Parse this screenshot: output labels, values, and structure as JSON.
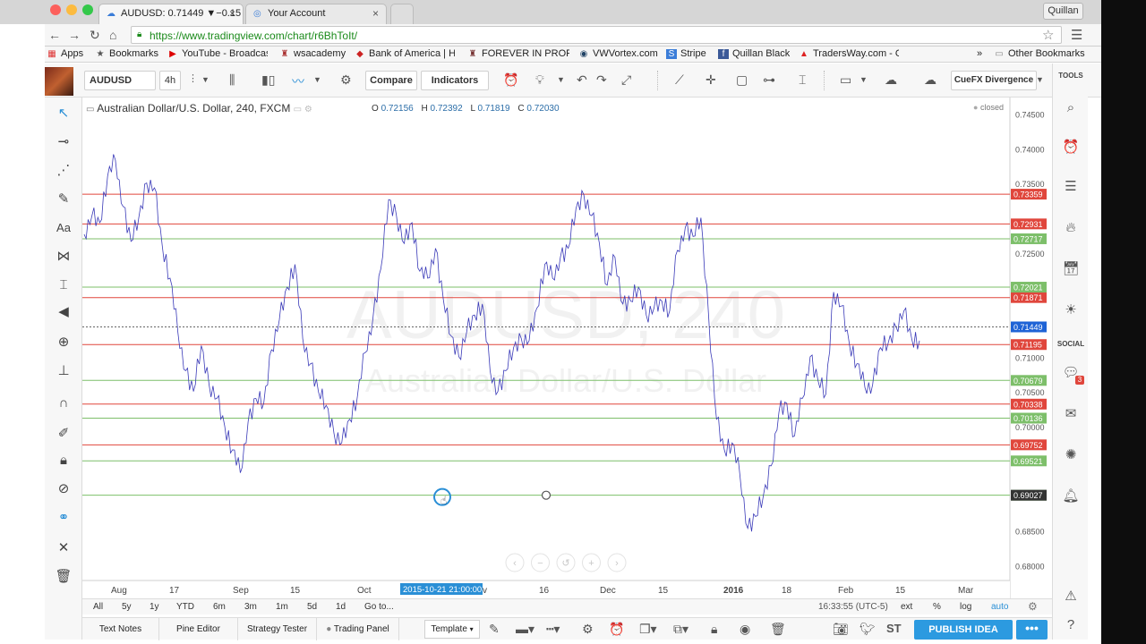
{
  "browser": {
    "tabs": [
      {
        "title": "AUDUSD: 0.71449 ▼−0.15",
        "active": true
      },
      {
        "title": "Your Account",
        "active": false
      }
    ],
    "user": "Quillan",
    "url": "https://www.tradingview.com/chart/r6BhToIt/",
    "bookmarks": [
      "Apps",
      "Bookmarks",
      "YouTube - Broadcast",
      "wsacademy",
      "Bank of America | Ho",
      "FOREVER IN PROFIT",
      "VWVortex.com",
      "Stripe",
      "Quillan Black",
      "TradersWay.com - O",
      "Other Bookmarks"
    ],
    "bookmarks_more": "»"
  },
  "toolbar": {
    "symbol": "AUDUSD",
    "interval": "4h",
    "compare": "Compare",
    "indicators": "Indicators",
    "template_name": "CueFX Divergence",
    "tools_label": "TOOLS",
    "social_label": "SOCIAL",
    "social_badge": "3"
  },
  "chart_header": {
    "title": "Australian Dollar/U.S. Dollar, 240, FXCM",
    "o_label": "O",
    "o_value": "0.72156",
    "h_label": "H",
    "h_value": "0.72392",
    "l_label": "L",
    "l_value": "0.71819",
    "c_label": "C",
    "c_value": "0.72030",
    "status": "closed"
  },
  "watermark": {
    "line1": "AUDUSD, 240",
    "line2": "Australian Dollar/U.S. Dollar"
  },
  "chart_data": {
    "type": "line",
    "series_color": "#3a3ab8",
    "ylim": [
      0.678,
      0.7475
    ],
    "y_ticks": [
      "0.74500",
      "0.74000",
      "0.73500",
      "0.72500",
      "0.71000",
      "0.70500",
      "0.70000",
      "0.68500",
      "0.68000"
    ],
    "x_ticks": [
      "Aug",
      "17",
      "Sep",
      "15",
      "Oct",
      "16",
      "Dec",
      "15",
      "2016",
      "18",
      "Feb",
      "15",
      "Mar"
    ],
    "x_ticks_partial": "v",
    "crosshair_date": "2015-10-21 21:00:00",
    "last_price": "0.71449",
    "resistance_levels": [
      "0.73359",
      "0.72931",
      "0.71871",
      "0.71195",
      "0.70338",
      "0.69752"
    ],
    "support_levels": [
      "0.72717",
      "0.72021",
      "0.70679",
      "0.70136",
      "0.69521",
      "0.69027"
    ],
    "colors": {
      "resistance": "#e0463c",
      "support": "#7dbf6a",
      "last": "#1e63d6",
      "dark": "#333333"
    },
    "closes": [
      0.7278,
      0.7305,
      0.7295,
      0.7362,
      0.7385,
      0.7318,
      0.7268,
      0.7302,
      0.7352,
      0.7345,
      0.7262,
      0.7215,
      0.7138,
      0.7082,
      0.7052,
      0.7118,
      0.7062,
      0.7042,
      0.7002,
      0.6968,
      0.6935,
      0.7008,
      0.7042,
      0.7035,
      0.7112,
      0.7155,
      0.7202,
      0.7235,
      0.7128,
      0.7092,
      0.7052,
      0.7032,
      0.6992,
      0.6978,
      0.7012,
      0.7045,
      0.7108,
      0.7158,
      0.7228,
      0.7328,
      0.7305,
      0.7265,
      0.7295,
      0.7225,
      0.7215,
      0.7258,
      0.7185,
      0.7132,
      0.7102,
      0.7138,
      0.7162,
      0.7178,
      0.7082,
      0.7052,
      0.7082,
      0.7115,
      0.7128,
      0.7125,
      0.7172,
      0.7235,
      0.7215,
      0.7245,
      0.7258,
      0.7315,
      0.7335,
      0.7305,
      0.7265,
      0.7205,
      0.7245,
      0.7178,
      0.7182,
      0.7202,
      0.7162,
      0.7172,
      0.7182,
      0.7168,
      0.7255,
      0.7288,
      0.7275,
      0.7302,
      0.7158,
      0.7012,
      0.6968,
      0.6978,
      0.6932,
      0.6855,
      0.6872,
      0.6902,
      0.6945,
      0.7022,
      0.7035,
      0.6988,
      0.7042,
      0.7102,
      0.7068,
      0.7048,
      0.7195,
      0.7175,
      0.7122,
      0.7092,
      0.7058,
      0.7062,
      0.7115,
      0.7122,
      0.7145,
      0.7168,
      0.7128,
      0.7125
    ]
  },
  "range_buttons": [
    "All",
    "5y",
    "1y",
    "YTD",
    "6m",
    "3m",
    "1m",
    "5d",
    "1d",
    "Go to..."
  ],
  "range_right": [
    "ext",
    "%",
    "log",
    "auto"
  ],
  "clock": "16:33:55 (UTC-5)",
  "bottom_tabs": [
    "Text Notes",
    "Pine Editor",
    "Strategy Tester",
    "Trading Panel"
  ],
  "bottom_toolbar": {
    "template": "Template",
    "st": "ST",
    "publish": "PUBLISH IDEA",
    "more": "•••"
  }
}
